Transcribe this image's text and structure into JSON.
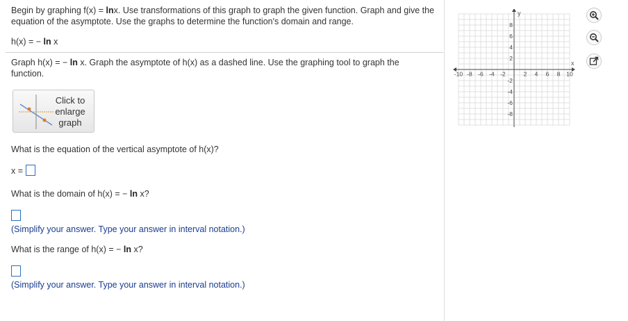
{
  "intro": {
    "part1": "Begin by graphing f(x) = ",
    "ln1": "ln",
    "part2": "x. Use transformations of this graph to graph the given function. Graph and give the equation of the asymptote. Use the graphs to determine the function's domain and range."
  },
  "function_def": {
    "prefix": "h(x) = − ",
    "ln": "ln",
    "suffix": "x"
  },
  "task": {
    "part1": "Graph h(x) = − ",
    "ln": "ln",
    "part2": "x. Graph the asymptote of h(x) as a dashed line. Use the graphing tool to graph the function."
  },
  "enlarge_button": {
    "line1": "Click to",
    "line2": "enlarge",
    "line3": "graph"
  },
  "q1": {
    "text": "What is the equation of the vertical asymptote of h(x)?",
    "prefix": "x ="
  },
  "q2": {
    "prefix": "What is the domain of h(x) = − ",
    "ln": "ln",
    "suffix": "x?",
    "hint": "(Simplify your answer. Type your answer in interval notation.)"
  },
  "q3": {
    "prefix": "What is the range of h(x) = − ",
    "ln": "ln",
    "suffix": "x?",
    "hint": "(Simplify your answer. Type your answer in interval notation.)"
  },
  "graph": {
    "x_axis_label": "x",
    "y_axis_label": "y",
    "x_ticks": [
      "-10",
      "-8",
      "-6",
      "-4",
      "-2",
      "2",
      "4",
      "6",
      "8",
      "10"
    ],
    "y_ticks": [
      "8",
      "6",
      "4",
      "2",
      "-2",
      "-4",
      "-6",
      "-8"
    ],
    "range": [
      -10,
      10
    ]
  },
  "tools": [
    {
      "icon": "zoom-in-icon"
    },
    {
      "icon": "zoom-out-icon"
    },
    {
      "icon": "popout-icon"
    }
  ],
  "colors": {
    "hint": "#1a3d8f",
    "answer_box_border": "#2a6ebb",
    "grid": "#d9d9d9"
  }
}
